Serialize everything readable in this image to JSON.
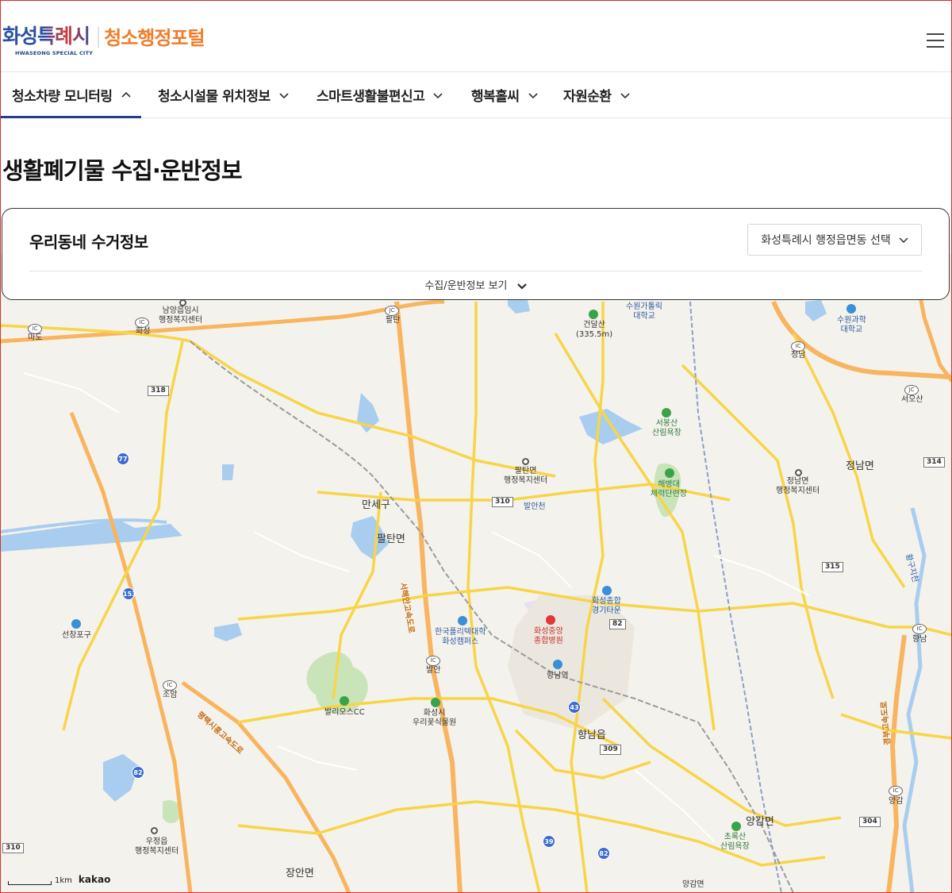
{
  "header": {
    "logo_city": "화성특례시",
    "logo_city_en": "HWASEONG SPECIAL CITY",
    "logo_portal": "청소행정포털",
    "menu_icon": "hamburger-menu-icon"
  },
  "nav": {
    "items": [
      {
        "label": "청소차량 모니터링",
        "active": true
      },
      {
        "label": "청소시설물 위치정보",
        "active": false
      },
      {
        "label": "스마트생활불편신고",
        "active": false
      },
      {
        "label": "행복홀씨",
        "active": false
      },
      {
        "label": "자원순환",
        "active": false
      }
    ],
    "accent_color": "#1f3f8f"
  },
  "page": {
    "title": "생활폐기물 수집·운반정보"
  },
  "card": {
    "title": "우리동네 수거정보",
    "select_label": "화성특례시 행정읍면동 선택",
    "toggle_label": "수집/운반정보 보기"
  },
  "map": {
    "labels": {
      "namyang": "남양읍임시\n행정복지센터",
      "hwaseong_ic": "화성",
      "mado": "마도",
      "paltan_jc": "팔탄",
      "geondalsan": "건달산\n(335.5m)",
      "suwon_catholic": "수원가톨릭\n대학교",
      "suwon_science": "수원과학\n대학교",
      "jeongnam_ic": "정남",
      "seoosan": "서오산",
      "seobongsan": "서봉산\n산림욕장",
      "paltan_office": "팔탄면\n행정복지센터",
      "haebyeongdae": "해병대\n체력단련장",
      "jeongnam_office": "정남면\n행정복지센터",
      "jeongnam_myeon": "정남면",
      "manse_gu": "만세구",
      "paltan_myeon": "팔탄면",
      "balan_cheon": "발안천",
      "hwaseong_stadium": "화성종합\n경기타운",
      "polytech": "한국폴리텍대학\n화성캠퍼스",
      "hwaseong_hospital": "화성중앙\n종합병원",
      "hyangnam_station": "향남역",
      "seonchang": "선창포구",
      "jodam_ic": "조암",
      "balan_ic": "발안",
      "bario_cc": "발리오스CC",
      "botanical": "화성시\n우리꽃식물원",
      "hyangnam_eup": "향남읍",
      "hyangnam_ic": "향남",
      "yanggam_myeon": "양감면",
      "chorok_forest": "초록산\n산림욕장",
      "yanggam_ic": "양감",
      "ujeong": "우정읍\n행정복지센터",
      "jangan": "장안면",
      "yanggam_office": "양감면",
      "expressway_1": "서해안고속도로",
      "expressway_2": "평택시흥고속도로",
      "expressway_3": "경부고속도로",
      "river": "황구지천"
    },
    "routes": [
      "318",
      "77",
      "153",
      "310",
      "82",
      "43",
      "309",
      "39",
      "82",
      "315",
      "314",
      "304",
      "82",
      "310"
    ],
    "scale_label": "1km",
    "provider": "kakao"
  }
}
